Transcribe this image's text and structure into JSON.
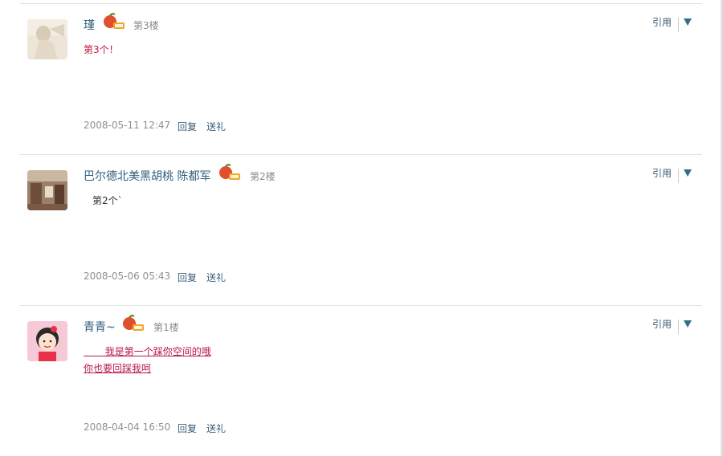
{
  "posts": [
    {
      "username": "瑾",
      "floor": "第3楼",
      "content": [
        "第3个！"
      ],
      "timestamp": "2008-05-11 12:47",
      "reply_label": "回复",
      "gift_label": "送礼",
      "quote_label": "引用",
      "badge_icon": "peach-level-badge-icon"
    },
    {
      "username": "巴尔德北美黑胡桃 陈都军",
      "floor": "第2楼",
      "content": [
        "第2个`"
      ],
      "timestamp": "2008-05-06 05:43",
      "reply_label": "回复",
      "gift_label": "送礼",
      "quote_label": "引用",
      "badge_icon": "peach-level-badge-icon"
    },
    {
      "username": "青青~",
      "floor": "第1楼",
      "content": [
        "       我是第一个踩你空间的哦",
        "你也要回踩我呵"
      ],
      "timestamp": "2008-04-04 16:50",
      "reply_label": "回复",
      "gift_label": "送礼",
      "quote_label": "引用",
      "badge_icon": "peach-level-badge-icon"
    }
  ],
  "colors": {
    "username": "#2f5d7c",
    "link": "#3a5d78",
    "content_red": "#c8173f",
    "timestamp": "#909090"
  }
}
